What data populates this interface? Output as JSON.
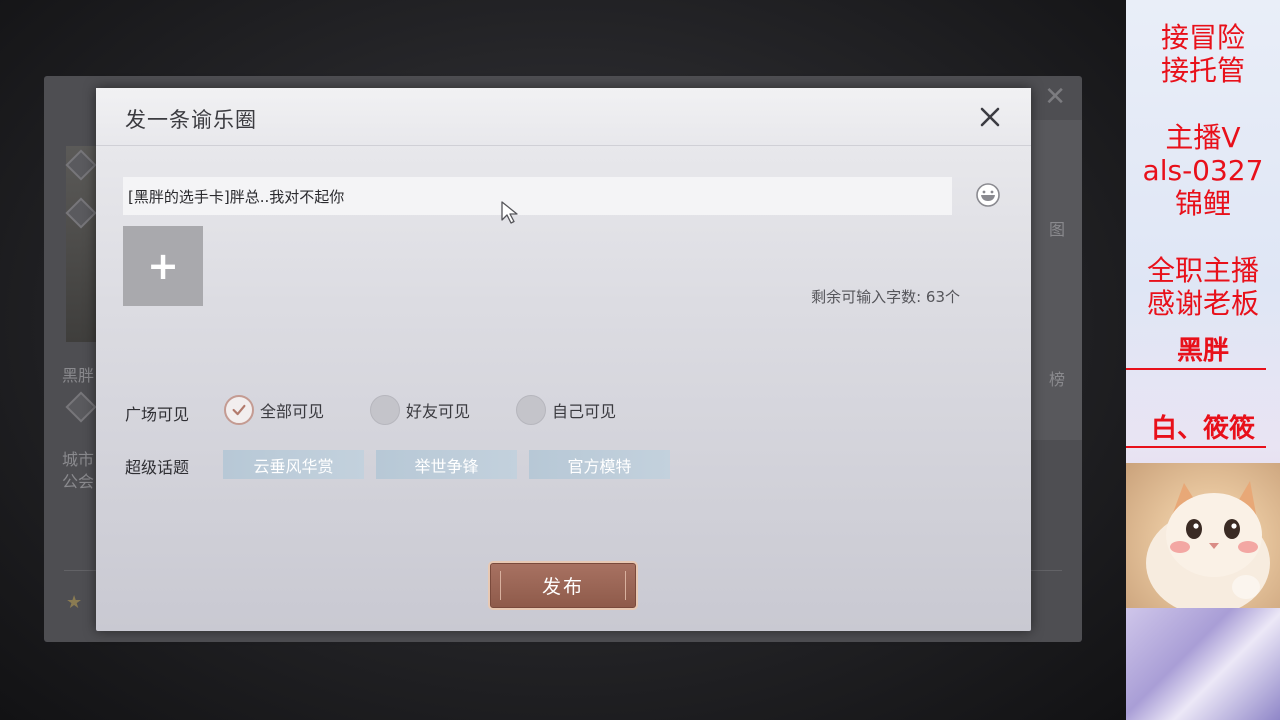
{
  "dialog": {
    "title": "发一条谕乐圈",
    "input_value": "[黑胖的选手卡]胖总..我对不起你",
    "char_counter": "剩余可输入字数: 63个",
    "add_image_symbol": "+",
    "visibility_label": "广场可见",
    "visibility_options": [
      {
        "label": "全部可见",
        "checked": true
      },
      {
        "label": "好友可见",
        "checked": false
      },
      {
        "label": "自己可见",
        "checked": false
      }
    ],
    "topics_label": "超级话题",
    "topics": [
      "云垂风华赏",
      "举世争锋",
      "官方模特"
    ],
    "publish_label": "发布"
  },
  "background": {
    "left_text_1": "黑胖",
    "left_text_2": "城市",
    "left_text_3": "公会",
    "right_text_1": "图",
    "right_text_2": "榜"
  },
  "overlay": {
    "lines": [
      "接冒险",
      "接托管",
      "主播V",
      "als-0327",
      "锦鲤",
      "全职主播",
      "感谢老板",
      "黑胖",
      "白、筱筱"
    ]
  },
  "colors": {
    "overlay_red": "#e8101a",
    "publish_brown": "#9a6454",
    "topic_blue": "#bccbd8"
  }
}
